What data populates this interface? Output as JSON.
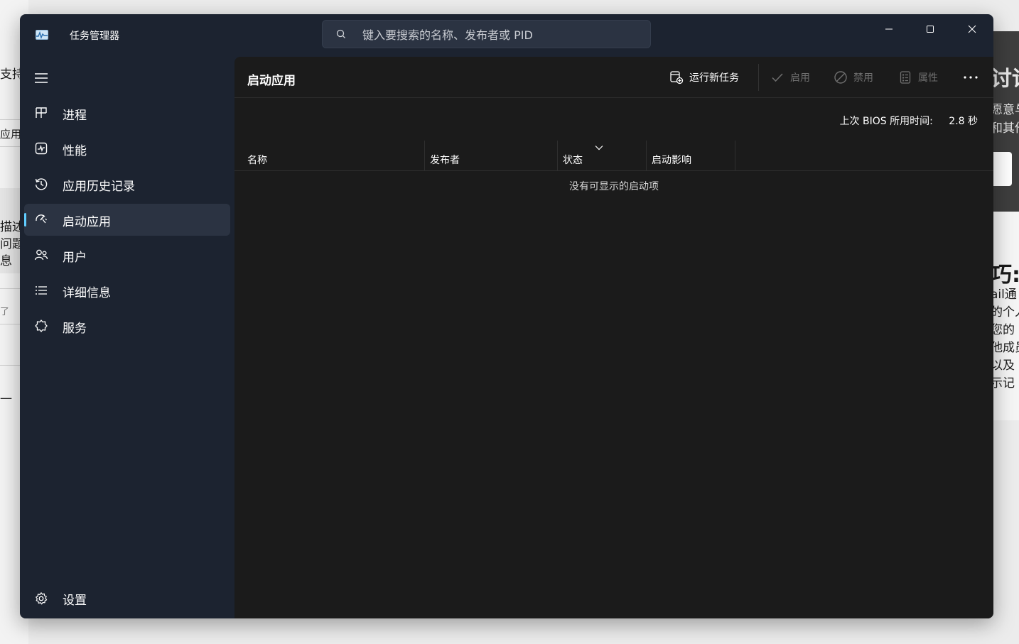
{
  "window": {
    "title": "任务管理器"
  },
  "search": {
    "placeholder": "键入要搜索的名称、发布者或 PID"
  },
  "sidebar": {
    "items": [
      {
        "label": "进程",
        "icon": "processes-icon"
      },
      {
        "label": "性能",
        "icon": "performance-icon"
      },
      {
        "label": "应用历史记录",
        "icon": "history-icon"
      },
      {
        "label": "启动应用",
        "icon": "startup-icon",
        "active": true
      },
      {
        "label": "用户",
        "icon": "users-icon"
      },
      {
        "label": "详细信息",
        "icon": "details-icon"
      },
      {
        "label": "服务",
        "icon": "services-icon"
      }
    ],
    "settings_label": "设置"
  },
  "page": {
    "title": "启动应用",
    "commands": {
      "run_new_task": "运行新任务",
      "enable": "启用",
      "disable": "禁用",
      "properties": "属性"
    },
    "bios_label": "上次 BIOS 所用时间:",
    "bios_value": "2.8 秒",
    "columns": [
      "名称",
      "发布者",
      "状态",
      "启动影响"
    ],
    "empty_message": "没有可显示的启动项"
  },
  "background": {
    "left_texts": [
      "支持",
      "应用",
      "描述",
      "问题",
      "息",
      "了",
      "一"
    ],
    "right_texts": [
      "讨论",
      "愿意与",
      "和其他",
      "巧:",
      "ail通",
      "的个人",
      "您的",
      "他成员",
      "以及",
      "示记"
    ]
  },
  "colors": {
    "accent": "#60cdff",
    "sidebar_bg": "#1c2330",
    "content_bg": "#1b1b1b",
    "selected_bg": "#2b3342"
  }
}
